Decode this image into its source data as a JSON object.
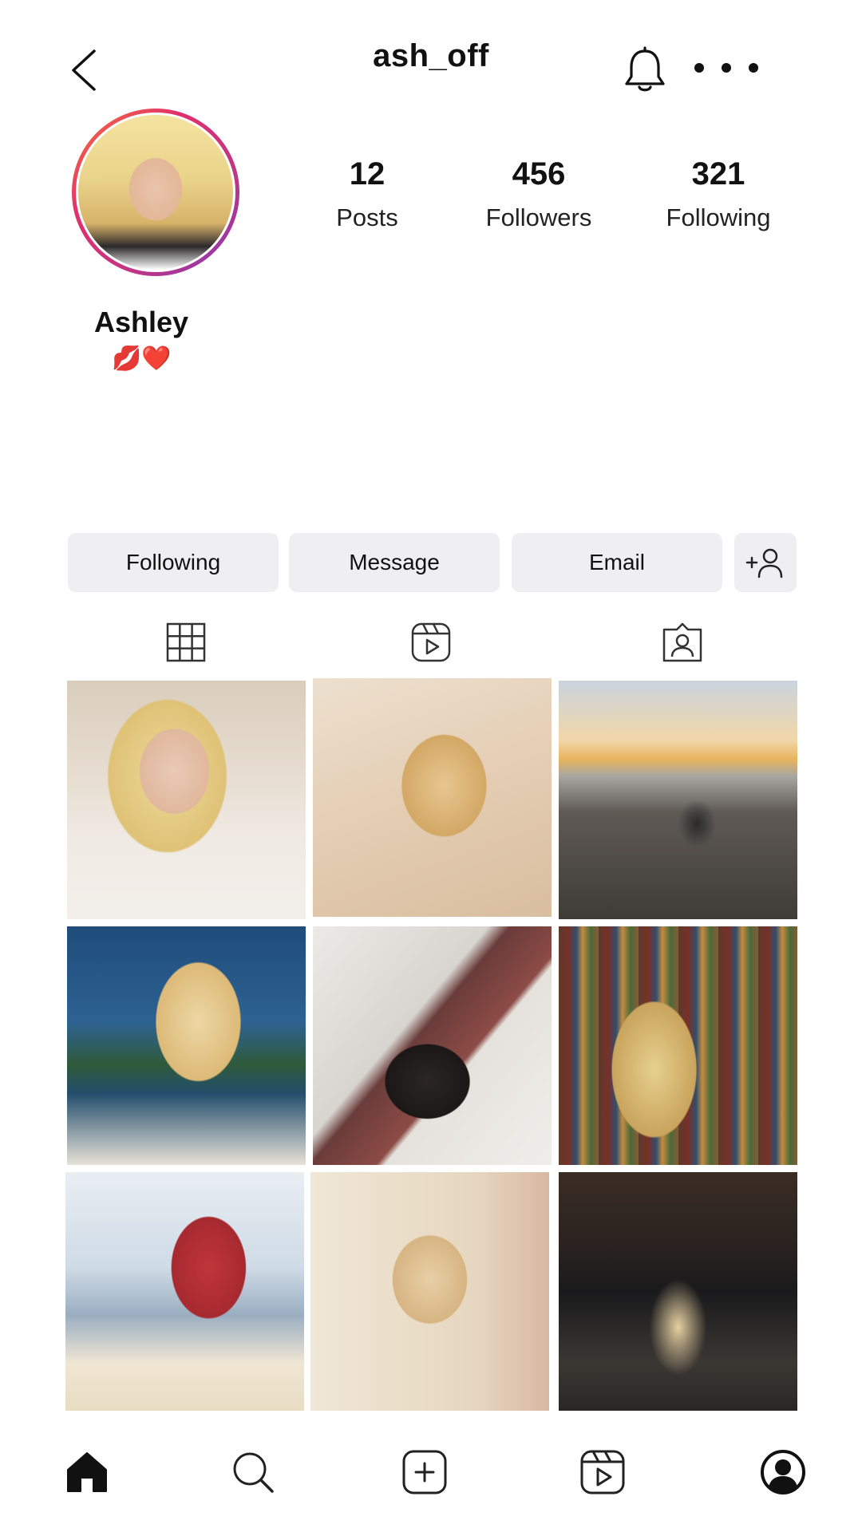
{
  "header": {
    "username": "ash_off"
  },
  "profile": {
    "stats": [
      {
        "value": "12",
        "label": "Posts"
      },
      {
        "value": "456",
        "label": "Followers"
      },
      {
        "value": "321",
        "label": "Following"
      }
    ],
    "display_name": "Ashley",
    "bio": "💋❤️"
  },
  "actions": {
    "following_label": "Following",
    "message_label": "Message",
    "email_label": "Email"
  },
  "icons": {
    "back": "chevron-left-icon",
    "notifications": "bell-icon",
    "more": "more-dots-icon",
    "add_person": "add-person-icon",
    "grid_tab": "grid-icon",
    "reels_tab": "reels-icon",
    "tagged_tab": "tagged-icon",
    "home": "home-icon",
    "search": "search-icon",
    "create": "add-post-icon",
    "reels": "reels-icon",
    "profile": "profile-icon"
  },
  "colors": {
    "story_ring_start": "#f77737",
    "story_ring_end": "#833ab4",
    "button_bg": "#efeff1",
    "text": "#111111"
  }
}
